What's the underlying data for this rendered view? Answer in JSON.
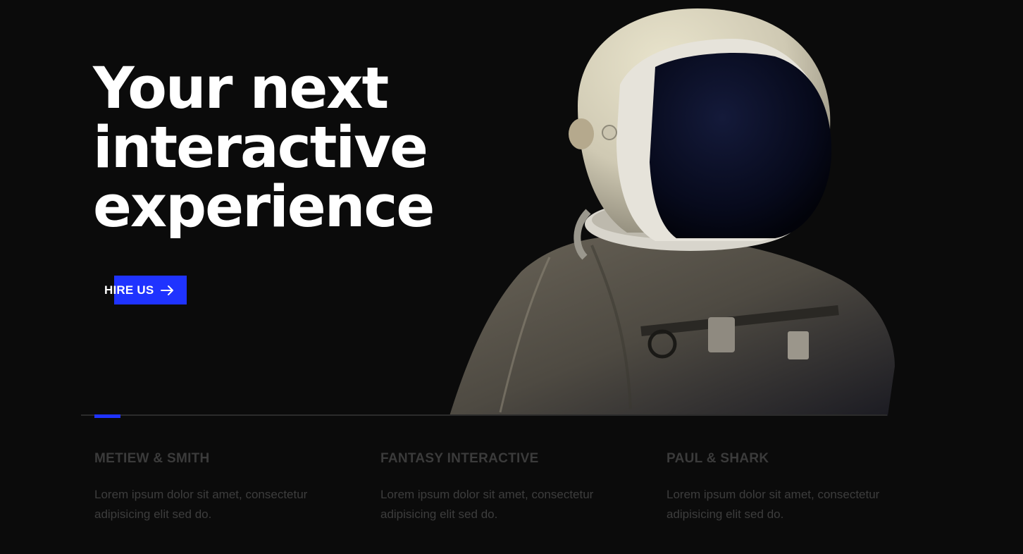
{
  "hero": {
    "title_lines": [
      "Your next",
      "interactive",
      "experience"
    ]
  },
  "cta": {
    "label": "HIRE US",
    "icon": "arrow-right-icon",
    "color": "#1f33ff"
  },
  "slider": {
    "active_index": 0
  },
  "clients": [
    {
      "name": "METIEW & SMITH",
      "description": "Lorem ipsum dolor sit amet, consectetur adipisicing elit sed do."
    },
    {
      "name": "FANTASY INTERACTIVE",
      "description": "Lorem ipsum dolor sit amet, consectetur adipisicing elit sed do."
    },
    {
      "name": "PAUL & SHARK",
      "description": "Lorem ipsum dolor sit amet, consectetur adipisicing elit sed do."
    }
  ],
  "colors": {
    "background": "#0b0b0b",
    "accent": "#1f33ff",
    "muted_text": "#3b3b3b"
  }
}
